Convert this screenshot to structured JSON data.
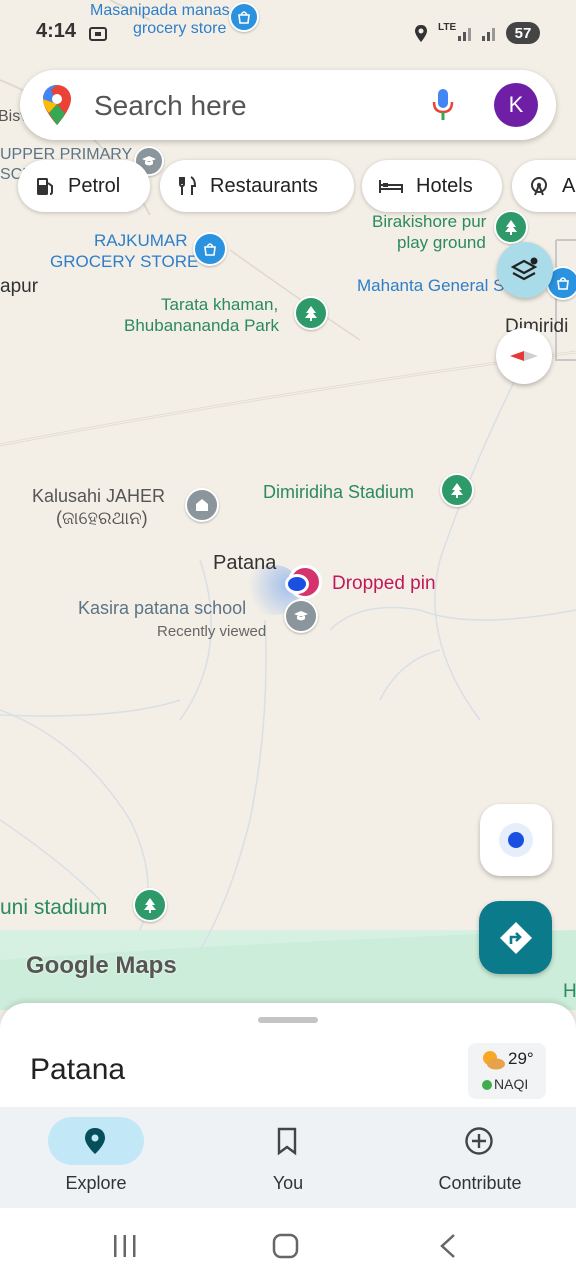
{
  "status_bar": {
    "time": "4:14",
    "network": "LTE",
    "battery": "57"
  },
  "search": {
    "placeholder": "Search here",
    "avatar_letter": "K"
  },
  "chips": [
    "Petrol",
    "Restaurants",
    "Hotels",
    "A"
  ],
  "map": {
    "labels": {
      "masanipada": "Masanipada manas",
      "masanipada2": "grocery store",
      "bisw": "Bisv",
      "upper_primary": "UPPER PRIMARY",
      "upper_primary2": "SCHO",
      "birakishore": "Birakishore pur",
      "birakishore2": "play ground",
      "rajkumar": "RAJKUMAR",
      "rajkumar2": "GROCERY STORE",
      "mahanta": "Mahanta General S",
      "apur": "apur",
      "tarata": "Tarata khaman,",
      "tarata2": "Bhubanananda Park",
      "dimiridi": "Dimiridi",
      "kalusahi": "Kalusahi JAHER",
      "kalusahi2": "(ଜାହେରଥାନ)",
      "stadium": "Dimiridiha Stadium",
      "patana": "Patana",
      "dropped_pin": "Dropped pin",
      "school": "Kasira patana school",
      "recently": "Recently viewed",
      "uni_stadium": "uni stadium",
      "brand": "Google Maps",
      "edge_h": "H"
    }
  },
  "sheet": {
    "title": "Patana",
    "temperature": "29°",
    "aqi": "NAQI"
  },
  "nav": {
    "explore": "Explore",
    "you": "You",
    "contribute": "Contribute"
  },
  "colors": {
    "accent": "#0b7a8a",
    "avatar": "#6e1fa5",
    "pin": "#c2185b",
    "park": "#2e9a6a"
  }
}
